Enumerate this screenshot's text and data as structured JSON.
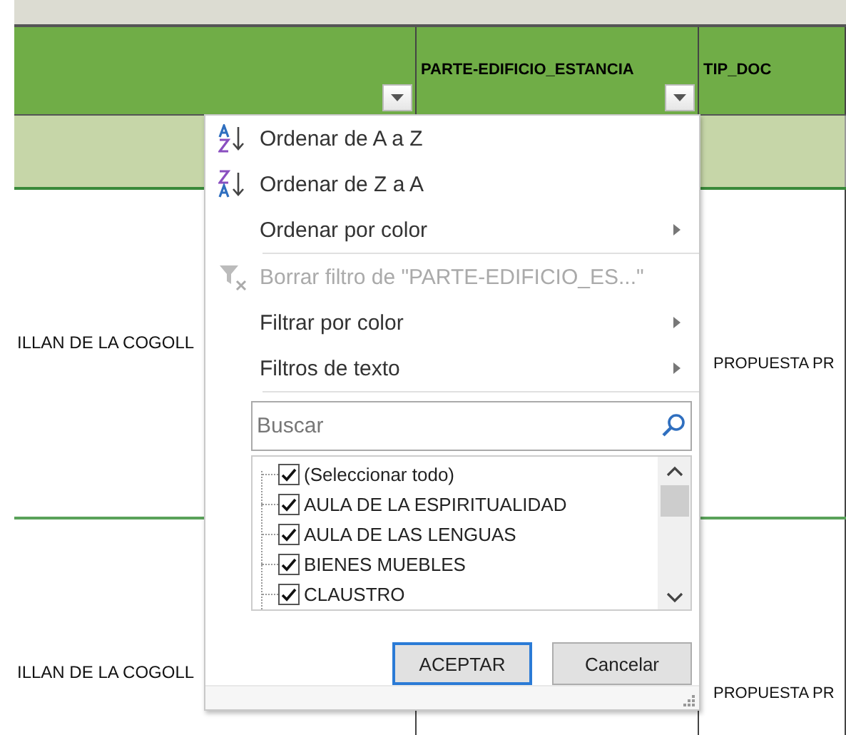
{
  "sheet": {
    "header": [
      {
        "filter": true
      },
      {
        "label": "PARTE-EDIFICIO_ESTANCIA",
        "filter": true
      },
      {
        "label": "TIP_DOC",
        "filter": false
      }
    ],
    "rows": [
      {
        "cells": [
          "ILLAN DE LA COGOLL",
          "",
          "PROPUESTA PR"
        ]
      },
      {
        "cells": [
          "ILLAN DE LA COGOLL",
          "",
          "PROPUESTA PR"
        ]
      }
    ]
  },
  "filter_menu": {
    "items": [
      {
        "kind": "sort-az",
        "label": "Ordenar de A a Z",
        "disabled": false,
        "submenu": false,
        "separator_after": false
      },
      {
        "kind": "sort-za",
        "label": "Ordenar de Z a A",
        "disabled": false,
        "submenu": false,
        "separator_after": false
      },
      {
        "kind": "plain",
        "label": "Ordenar por color",
        "disabled": false,
        "submenu": true,
        "separator_after": true
      },
      {
        "kind": "clear-filter",
        "label": "Borrar filtro de \"PARTE-EDIFICIO_ES...\"",
        "disabled": true,
        "submenu": false,
        "separator_after": false
      },
      {
        "kind": "plain",
        "label": "Filtrar por color",
        "disabled": false,
        "submenu": true,
        "separator_after": false
      },
      {
        "kind": "plain",
        "label": "Filtros de texto",
        "disabled": false,
        "submenu": true,
        "separator_after": true
      }
    ],
    "search": {
      "placeholder": "Buscar"
    },
    "values": [
      {
        "label": "(Seleccionar todo)",
        "checked": true
      },
      {
        "label": "AULA DE LA ESPIRITUALIDAD",
        "checked": true
      },
      {
        "label": "AULA DE LAS LENGUAS",
        "checked": true
      },
      {
        "label": "BIENES MUEBLES",
        "checked": true
      },
      {
        "label": "CLAUSTRO",
        "checked": true
      }
    ],
    "buttons": [
      {
        "label": "ACEPTAR",
        "default": true
      },
      {
        "label": "Cancelar",
        "default": false
      }
    ]
  }
}
